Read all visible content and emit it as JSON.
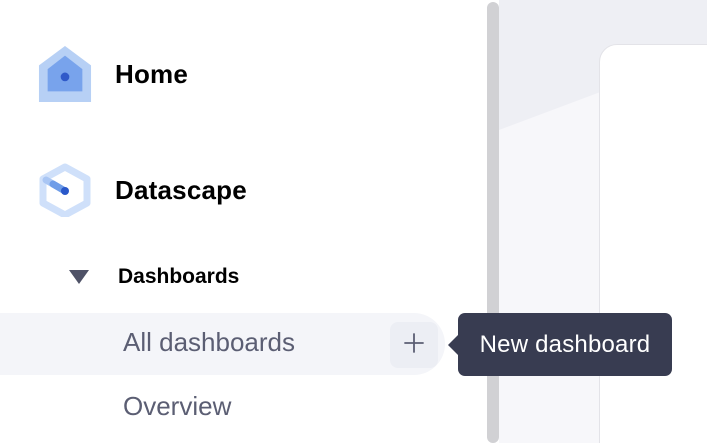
{
  "sidebar": {
    "apps": [
      {
        "label": "Home",
        "icon": "home-icon"
      },
      {
        "label": "Datascape",
        "icon": "datascape-logo-icon"
      }
    ],
    "section": {
      "label": "Dashboards",
      "expanded": true,
      "icon": "caret-down-icon"
    },
    "items": [
      {
        "label": "All dashboards",
        "active": true
      },
      {
        "label": "Overview",
        "active": false
      }
    ],
    "add_button_icon": "plus-icon"
  },
  "tooltip": {
    "text": "New dashboard"
  },
  "colors": {
    "accent_blue": "#3d6de0",
    "icon_light_blue": "#b7d0f5",
    "tooltip_bg": "#383c51",
    "subitem_text": "#5b5e73",
    "row_highlight": "#f4f5f9"
  }
}
